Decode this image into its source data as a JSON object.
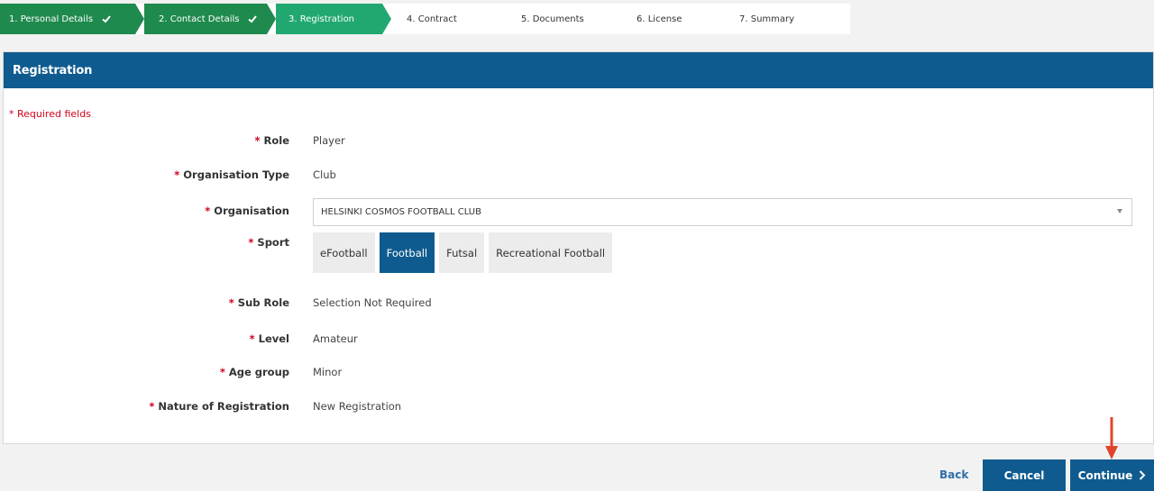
{
  "stepper": {
    "steps": [
      {
        "label": "1. Personal Details",
        "state": "done"
      },
      {
        "label": "2. Contact Details",
        "state": "done"
      },
      {
        "label": "3. Registration",
        "state": "active"
      },
      {
        "label": "4. Contract",
        "state": "todo"
      },
      {
        "label": "5. Documents",
        "state": "todo"
      },
      {
        "label": "6. License",
        "state": "todo"
      },
      {
        "label": "7. Summary",
        "state": "todo"
      }
    ]
  },
  "panel": {
    "title": "Registration",
    "required_note": "* Required fields"
  },
  "form": {
    "star": "*",
    "role": {
      "label": "Role",
      "value": "Player"
    },
    "org_type": {
      "label": "Organisation Type",
      "value": "Club"
    },
    "organisation": {
      "label": "Organisation",
      "value": "HELSINKI COSMOS FOOTBALL CLUB"
    },
    "sport": {
      "label": "Sport",
      "options": [
        "eFootball",
        "Football",
        "Futsal",
        "Recreational Football"
      ],
      "selected": "Football"
    },
    "sub_role": {
      "label": "Sub Role",
      "value": "Selection Not Required"
    },
    "level": {
      "label": "Level",
      "value": "Amateur"
    },
    "age_group": {
      "label": "Age group",
      "value": "Minor"
    },
    "nature": {
      "label": "Nature of Registration",
      "value": "New Registration"
    }
  },
  "footer": {
    "back_label": "Back",
    "cancel_label": "Cancel",
    "continue_label": "Continue",
    "continue_icon": "chevron-right-icon"
  },
  "colors": {
    "primary": "#0f5b8f",
    "step_done": "#1f8a4e",
    "step_active": "#21a871",
    "required": "#d0021b",
    "annotation": "#e0452b"
  }
}
